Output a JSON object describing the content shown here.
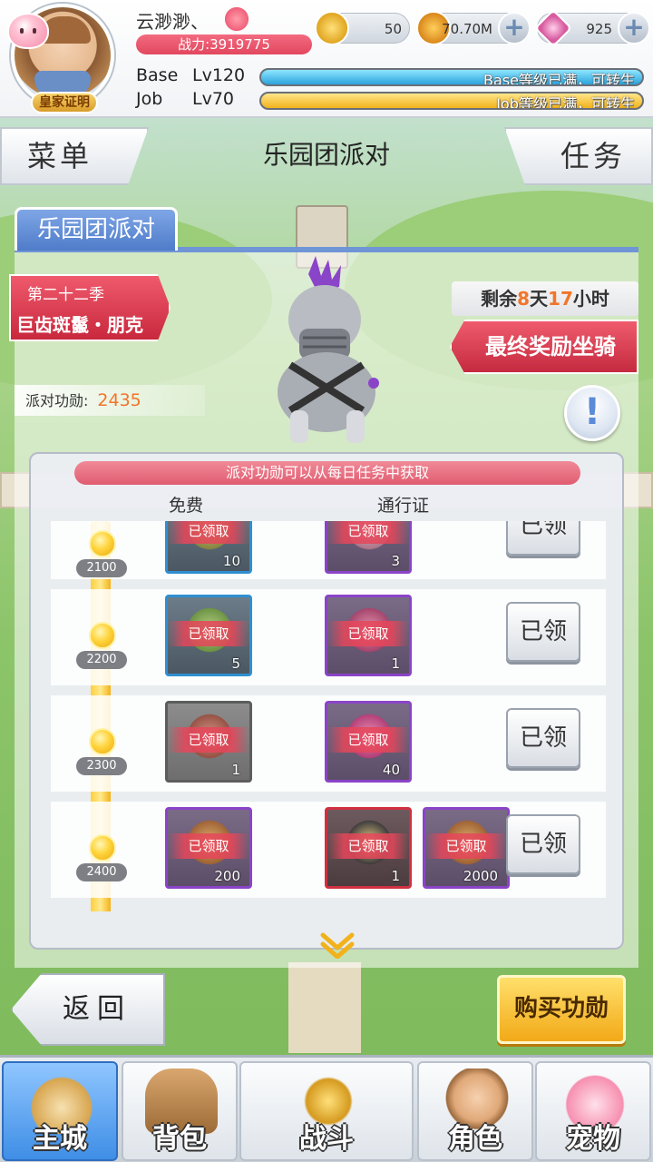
{
  "header": {
    "player_name": "云渺渺、",
    "badge_text": "皇家证明",
    "combat_power": "战力:3919775",
    "currencies": {
      "zeny": "50",
      "gold": "70.70M",
      "gems": "925"
    },
    "base": {
      "label": "Base",
      "level": "Lv120",
      "status": "Base等级已满，可转生"
    },
    "job": {
      "label": "Job",
      "level": "Lv70",
      "status": "Job等级已满，可转生"
    }
  },
  "titlebar": {
    "menu_label": "菜单",
    "title": "乐园团派对",
    "quest_label": "任务"
  },
  "panel": {
    "tab_label": "乐园团派对",
    "season": "第二十二季",
    "mount_name": "巨齿斑鬣・朋克",
    "time_left": {
      "prefix": "剩余",
      "days": "8",
      "day_unit": "天",
      "hours": "17",
      "hour_unit": "小时"
    },
    "final_reward_label": "最终奖励坐骑",
    "merit_label": "派对功勋:",
    "merit_value": "2435",
    "info_glyph": "!",
    "tip": "派对功勋可以从每日任务中获取",
    "col_free": "免费",
    "col_pass": "通行证"
  },
  "reward_rows": [
    {
      "threshold": "2100",
      "free": {
        "qty": "10",
        "status": "已领取",
        "rarity": "blue",
        "icon": "scroll-icon"
      },
      "pass": [
        {
          "qty": "3",
          "status": "已领取",
          "rarity": "purple",
          "icon": "card-icon"
        }
      ],
      "button": "已领"
    },
    {
      "threshold": "2200",
      "free": {
        "qty": "5",
        "status": "已领取",
        "rarity": "blue",
        "icon": "melon-icon"
      },
      "pass": [
        {
          "qty": "1",
          "status": "已领取",
          "rarity": "purple",
          "icon": "chest-icon"
        }
      ],
      "button": "已领"
    },
    {
      "threshold": "2300",
      "free": {
        "qty": "1",
        "status": "已领取",
        "rarity": "gray",
        "icon": "ore-icon"
      },
      "pass": [
        {
          "qty": "40",
          "status": "已领取",
          "rarity": "purple",
          "icon": "gem-icon"
        }
      ],
      "button": "已领"
    },
    {
      "threshold": "2400",
      "free": {
        "qty": "200",
        "status": "已领取",
        "rarity": "purple",
        "icon": "emblem-icon"
      },
      "pass": [
        {
          "qty": "1",
          "status": "已领取",
          "rarity": "red",
          "icon": "mount-icon"
        },
        {
          "qty": "2000",
          "status": "已领取",
          "rarity": "purple",
          "icon": "emblem-icon"
        }
      ],
      "button": "已领"
    }
  ],
  "actions": {
    "back_label": "返回",
    "buy_label": "购买功勋"
  },
  "nav": [
    {
      "label": "主城",
      "icon": "castle-icon",
      "active": true
    },
    {
      "label": "背包",
      "icon": "backpack-icon",
      "active": false
    },
    {
      "label": "战斗",
      "icon": "crossed-swords-icon",
      "active": false
    },
    {
      "label": "角色",
      "icon": "character-icon",
      "active": false
    },
    {
      "label": "宠物",
      "icon": "poring-icon",
      "active": false
    }
  ],
  "colors": {
    "accent_red": "#e0485f",
    "accent_blue": "#4f7cc9",
    "highlight_orange": "#f2752a",
    "track_gold": "#ffd43c"
  }
}
